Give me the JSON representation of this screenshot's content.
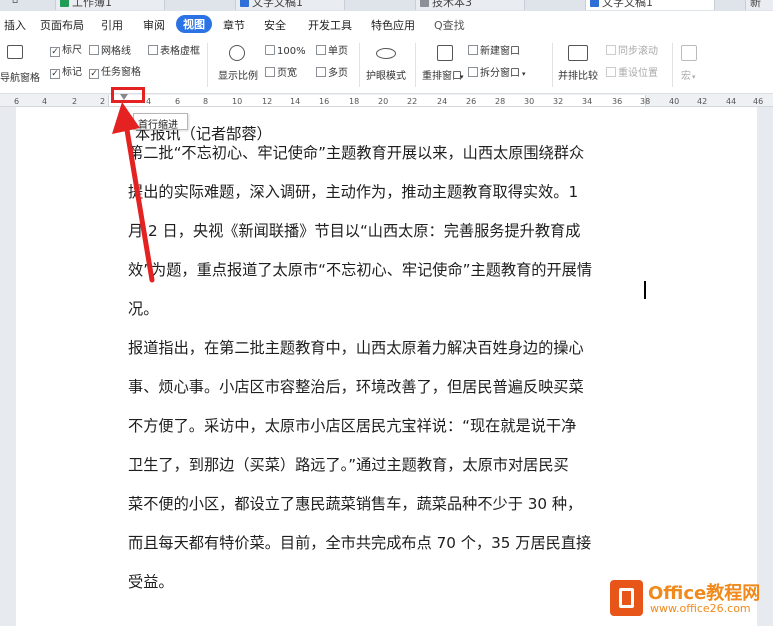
{
  "tabs": [
    "工作簿1",
    "文字文稿1",
    "技术本3",
    "文字文稿1"
  ],
  "tab_extra": "新",
  "menu": [
    "插入",
    "页面布局",
    "引用",
    "审阅",
    "视图",
    "章节",
    "安全",
    "开发工具",
    "特色应用"
  ],
  "menu_search": "Q查找",
  "ribbon": {
    "nav_pane": "导航窗格",
    "ruler": "标尺",
    "gridlines": "网格线",
    "table_gridlines": "表格虚框",
    "markup": "标记",
    "task_pane": "任务窗格",
    "zoom_label": "显示比例",
    "zoom_100": "100%",
    "page_width": "页宽",
    "single_page": "单页",
    "multi_page": "多页",
    "eye_mode": "护眼模式",
    "rearrange": "重排窗口",
    "new_window": "新建窗口",
    "split_window": "拆分窗口",
    "side_by_side": "并排比较",
    "sync_scroll": "同步滚动",
    "reset_position": "重设位置",
    "macro": "宏"
  },
  "ruler_ticks": [
    "6",
    "4",
    "2",
    "2",
    "4",
    "6",
    "8",
    "10",
    "12",
    "14",
    "16",
    "18",
    "20",
    "22",
    "24",
    "26",
    "28",
    "30",
    "32",
    "34",
    "36",
    "38",
    "40",
    "42",
    "44",
    "46"
  ],
  "tooltip": "首行缩进",
  "doc": {
    "lines": [
      "本报讯（记者郜蓉）",
      "第二批“不忘初心、牢记使命”主题教育开展以来，山西太原围绕群众",
      "提出的实际难题，深入调研，主动作为，推动主题教育取得实效。1",
      "月 2 日，央视《新闻联播》节目以“山西太原：完善服务提升教育成",
      "效”为题，重点报道了太原市“不忘初心、牢记使命”主题教育的开展情",
      "况。",
      "报道指出，在第二批主题教育中，山西太原着力解决百姓身边的操心",
      "事、烦心事。小店区市容整治后，环境改善了，但居民普遍反映买菜",
      "不方便了。采访中，太原市小店区居民亢宝祥说：“现在就是说干净",
      "卫生了，到那边（买菜）路远了。”通过主题教育，太原市对居民买",
      "菜不便的小区，都设立了惠民蔬菜销售车，蔬菜品种不少于 30 种，",
      "而且每天都有特价菜。目前，全市共完成布点 70 个，35 万居民直接",
      "受益。"
    ]
  },
  "watermark": {
    "title": "Office教程网",
    "url": "www.office26.com"
  },
  "colors": {
    "accent": "#2b73e5",
    "highlight": "#e42222",
    "watermark": "#f08a1c"
  }
}
